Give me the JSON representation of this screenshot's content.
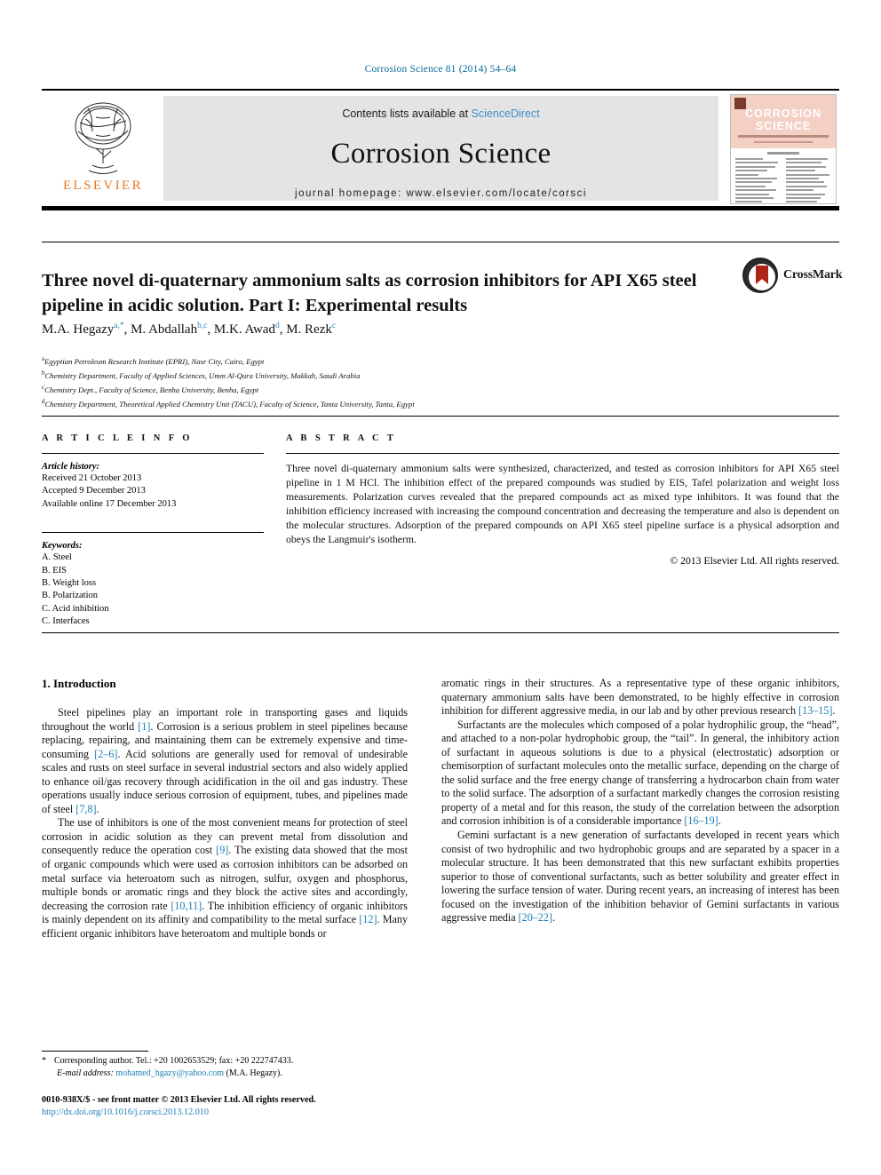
{
  "running_head": "Corrosion Science 81 (2014) 54–64",
  "masthead": {
    "contents_prefix": "Contents lists available at",
    "sciencedirect": "ScienceDirect",
    "journal_title": "Corrosion Science",
    "homepage": "journal homepage: www.elsevier.com/locate/corsci",
    "publisher": "ELSEVIER",
    "cover": {
      "line1": "CORROSION",
      "line2": "SCIENCE"
    }
  },
  "article": {
    "title": "Three novel di-quaternary ammonium salts as corrosion inhibitors for API X65 steel pipeline in acidic solution. Part I: Experimental results",
    "crossmark_label": "CrossMark",
    "authors": [
      {
        "name": "M.A. Hegazy",
        "marks": "a,*"
      },
      {
        "name": "M. Abdallah",
        "marks": "b,c"
      },
      {
        "name": "M.K. Awad",
        "marks": "d"
      },
      {
        "name": "M. Rezk",
        "marks": "c"
      }
    ],
    "affiliations": [
      {
        "label": "a",
        "text": "Egyptian Petroleum Research Institute (EPRI), Nasr City, Cairo, Egypt"
      },
      {
        "label": "b",
        "text": "Chemistry Department, Faculty of Applied Sciences, Umm Al-Qura University, Makkah, Saudi Arabia"
      },
      {
        "label": "c",
        "text": "Chemistry Dept., Faculty of Science, Benha University, Benha, Egypt"
      },
      {
        "label": "d",
        "text": "Chemistry Department, Theoretical Applied Chemistry Unit (TACU), Faculty of Science, Tanta University, Tanta, Egypt"
      }
    ]
  },
  "article_info": {
    "heading": "A R T I C L E    I N F O",
    "history_label": "Article history:",
    "history": [
      "Received 21 October 2013",
      "Accepted 9 December 2013",
      "Available online 17 December 2013"
    ],
    "keywords_label": "Keywords:",
    "keywords": [
      "A. Steel",
      "B. EIS",
      "B. Weight loss",
      "B. Polarization",
      "C. Acid inhibition",
      "C. Interfaces"
    ]
  },
  "abstract": {
    "heading": "A B S T R A C T",
    "text": "Three novel di-quaternary ammonium salts were synthesized, characterized, and tested as corrosion inhibitors for API X65 steel pipeline in 1 M HCl. The inhibition effect of the prepared compounds was studied by EIS, Tafel polarization and weight loss measurements. Polarization curves revealed that the prepared compounds act as mixed type inhibitors. It was found that the inhibition efficiency increased with increasing the compound concentration and decreasing the temperature and also is dependent on the molecular structures. Adsorption of the prepared compounds on API X65 steel pipeline surface is a physical adsorption and obeys the Langmuir's isotherm.",
    "copyright": "© 2013 Elsevier Ltd. All rights reserved."
  },
  "body": {
    "section_heading": "1. Introduction",
    "left_paragraphs": [
      {
        "parts": [
          {
            "t": "Steel pipelines play an important role in transporting gases and liquids throughout the world "
          },
          {
            "t": "[1]",
            "ref": true
          },
          {
            "t": ". Corrosion is a serious problem in steel pipelines because replacing, repairing, and maintaining them can be extremely expensive and time-consuming "
          },
          {
            "t": "[2–6]",
            "ref": true
          },
          {
            "t": ". Acid solutions are generally used for removal of undesirable scales and rusts on steel surface in several industrial sectors and also widely applied to enhance oil/gas recovery through acidification in the oil and gas industry. These operations usually induce serious corrosion of equipment, tubes, and pipelines made of steel "
          },
          {
            "t": "[7,8]",
            "ref": true
          },
          {
            "t": "."
          }
        ]
      },
      {
        "parts": [
          {
            "t": "The use of inhibitors is one of the most convenient means for protection of steel corrosion in acidic solution as they can prevent metal from dissolution and consequently reduce the operation cost "
          },
          {
            "t": "[9]",
            "ref": true
          },
          {
            "t": ". The existing data showed that the most of organic compounds which were used as corrosion inhibitors can be adsorbed on metal surface via heteroatom such as nitrogen, sulfur, oxygen and phosphorus, multiple bonds or aromatic rings and they block the active sites and accordingly, decreasing the corrosion rate "
          },
          {
            "t": "[10,11]",
            "ref": true
          },
          {
            "t": ". The inhibition efficiency of organic inhibitors is mainly dependent on its affinity and compatibility to the metal surface "
          },
          {
            "t": "[12]",
            "ref": true
          },
          {
            "t": ". Many efficient organic inhibitors have heteroatom and multiple bonds or"
          }
        ]
      }
    ],
    "right_paragraphs": [
      {
        "indent": false,
        "parts": [
          {
            "t": "aromatic rings in their structures. As a representative type of these organic inhibitors, quaternary ammonium salts have been demonstrated, to be highly effective in corrosion inhibition for different aggressive media, in our lab and by other previous research "
          },
          {
            "t": "[13–15]",
            "ref": true
          },
          {
            "t": "."
          }
        ]
      },
      {
        "indent": true,
        "parts": [
          {
            "t": "Surfactants are the molecules which composed of a polar hydrophilic group, the “head”, and attached to a non-polar hydrophobic group, the “tail”. In general, the inhibitory action of surfactant in aqueous solutions is due to a physical (electrostatic) adsorption or chemisorption of surfactant molecules onto the metallic surface, depending on the charge of the solid surface and the free energy change of transferring a hydrocarbon chain from water to the solid surface. The adsorption of a surfactant markedly changes the corrosion resisting property of a metal and for this reason, the study of the correlation between the adsorption and corrosion inhibition is of a considerable importance "
          },
          {
            "t": "[16–19]",
            "ref": true
          },
          {
            "t": "."
          }
        ]
      },
      {
        "indent": true,
        "parts": [
          {
            "t": "Gemini surfactant is a new generation of surfactants developed in recent years which consist of two hydrophilic and two hydrophobic groups and are separated by a spacer in a molecular structure. It has been demonstrated that this new surfactant exhibits properties superior to those of conventional surfactants, such as better solubility and greater effect in lowering the surface tension of water. During recent years, an increasing of interest has been focused on the investigation of the inhibition behavior of Gemini surfactants in various aggressive media "
          },
          {
            "t": "[20–22]",
            "ref": true
          },
          {
            "t": "."
          }
        ]
      }
    ]
  },
  "footnote": {
    "star": "*",
    "corresponding": "Corresponding author. Tel.: +20 1002653529; fax: +20 222747433.",
    "email_label": "E-mail address:",
    "email": "mohamed_hgazy@yahoo.com",
    "email_owner": "(M.A. Hegazy)."
  },
  "footer": {
    "issn": "0010-938X/$ - see front matter © 2013 Elsevier Ltd. All rights reserved.",
    "doi": "http://dx.doi.org/10.1016/j.corsci.2013.12.010"
  }
}
